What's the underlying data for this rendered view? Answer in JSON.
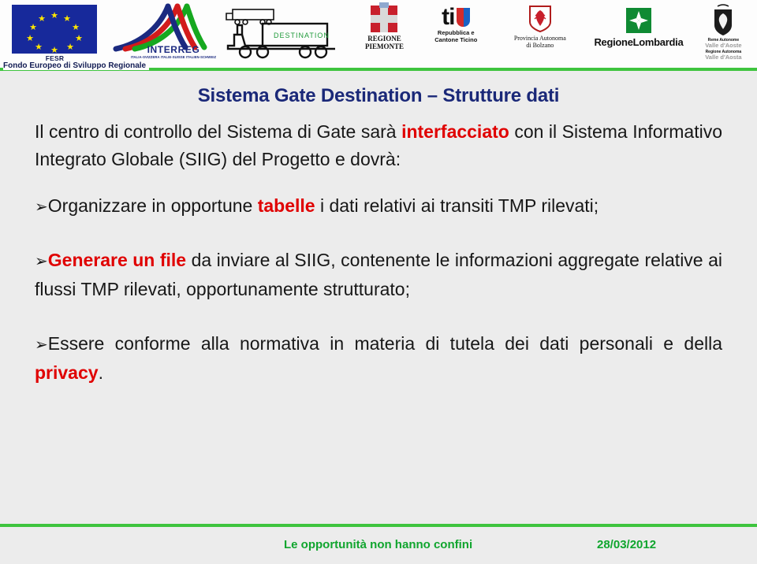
{
  "header": {
    "logos": [
      {
        "id": "eu-fesr",
        "name": "European Union flag",
        "label": "FESR",
        "caption": "Fondo Europeo di Sviluppo Regionale"
      },
      {
        "id": "interreg",
        "name": "Interreg programme logo",
        "label": "INTERREG",
        "caption": "ITALIA-SVIZZERA ITALIE-SUISSE ITALIEN-SCHWEIZ"
      },
      {
        "id": "destination",
        "name": "Destination project truck logo",
        "label": "DESTINATION",
        "caption": ""
      },
      {
        "id": "regione-piemonte",
        "name": "Regione Piemonte crest",
        "label": "",
        "caption": "REGIONE\nPIEMONTE"
      },
      {
        "id": "canton-ticino",
        "name": "Repubblica e Cantone Ticino logo",
        "label": "ti",
        "caption": "Repubblica e\nCantone Ticino"
      },
      {
        "id": "provincia-bolzano",
        "name": "Provincia Autonoma di Bolzano crest",
        "label": "",
        "caption": "Provincia Autonoma\ndi Bolzano"
      },
      {
        "id": "regione-lombardia",
        "name": "Regione Lombardia logo",
        "label": "RegioneLombardia",
        "caption": ""
      },
      {
        "id": "valle-aosta",
        "name": "Valle d'Aosta regional crest",
        "label": "",
        "caption": "Reme Autonome\nValle d'Aosta\nRegione Autonoma\nValle d'Aosta"
      }
    ],
    "fesr_strip": "Fondo Europeo di Sviluppo Regionale",
    "fesr_short": "FESR",
    "interreg_word": "INTERREG",
    "interreg_sub": "ITALIA-SVIZZERA ITALIE-SUISSE ITALIEN-SCHWEIZ",
    "destination_word": "DESTINATION",
    "piemonte_line1": "REGIONE",
    "piemonte_line2": "PIEMONTE",
    "ticino_word": "ti",
    "ticino_line1": "Repubblica e",
    "ticino_line2": "Cantone Ticino",
    "bolzano_line1": "Provincia Autonoma",
    "bolzano_line2": "di Bolzano",
    "lombardia_word": "RegioneLombardia",
    "vda_line1": "Reme Autonome",
    "vda_line2": "Valle d'Aoste",
    "vda_line3": "Regione Autonoma",
    "vda_line4": "Valle d'Aosta"
  },
  "slide": {
    "title": "Sistema Gate Destination – Strutture dati",
    "intro": {
      "part1": "Il centro di controllo del Sistema di Gate sarà ",
      "highlight": "interfacciato",
      "part2": " con il Sistema Informativo Integrato Globale (SIIG) del Progetto e dovrà:"
    },
    "bullet_glyph": "➢",
    "bullets": [
      {
        "pre": "Organizzare in opportune ",
        "highlight": "tabelle",
        "post": " i dati relativi ai transiti TMP rilevati;"
      },
      {
        "pre": "",
        "highlight": "Generare un file",
        "post": " da inviare al SIIG, contenente le informazioni aggregate relative ai flussi TMP rilevati, opportunamente strutturato;"
      },
      {
        "pre": "Essere conforme alla normativa in materia di tutela dei dati personali e della ",
        "highlight": "privacy",
        "post": "."
      }
    ]
  },
  "footer": {
    "motto": "Le opportunità non hanno confini",
    "date": "28/03/2012"
  },
  "colors": {
    "background": "#ececec",
    "title": "#1a2878",
    "highlight": "#e00000",
    "accent_green": "#3ec43e",
    "footer_green": "#10a52e",
    "eu_blue": "#17299b",
    "body_text": "#171717"
  }
}
